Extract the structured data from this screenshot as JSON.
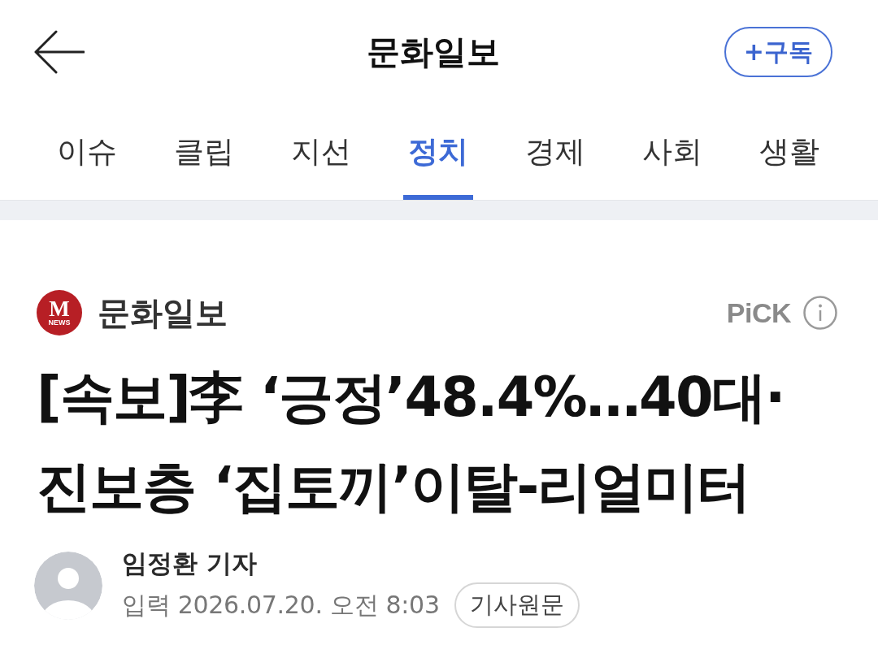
{
  "header": {
    "title": "문화일보",
    "subscribe_button": "+구독"
  },
  "tabs": [
    {
      "label": "이슈",
      "selected": false
    },
    {
      "label": "클립",
      "selected": false
    },
    {
      "label": "지선",
      "selected": false
    },
    {
      "label": "정치",
      "selected": true
    },
    {
      "label": "경제",
      "selected": false
    },
    {
      "label": "사회",
      "selected": false
    },
    {
      "label": "생활",
      "selected": false
    }
  ],
  "press": {
    "logo": {
      "letter": "M",
      "subtext": "NEWS"
    },
    "name": "문화일보",
    "pick_label": "PiCK"
  },
  "article": {
    "headline": "[속보]李 ‘긍정’48.4%…40대·진보층 ‘집토끼’이탈-리얼미터",
    "author": "임정환 기자",
    "published": "입력 2026.07.20. 오전 8:03",
    "original_button": "기사원문"
  }
}
